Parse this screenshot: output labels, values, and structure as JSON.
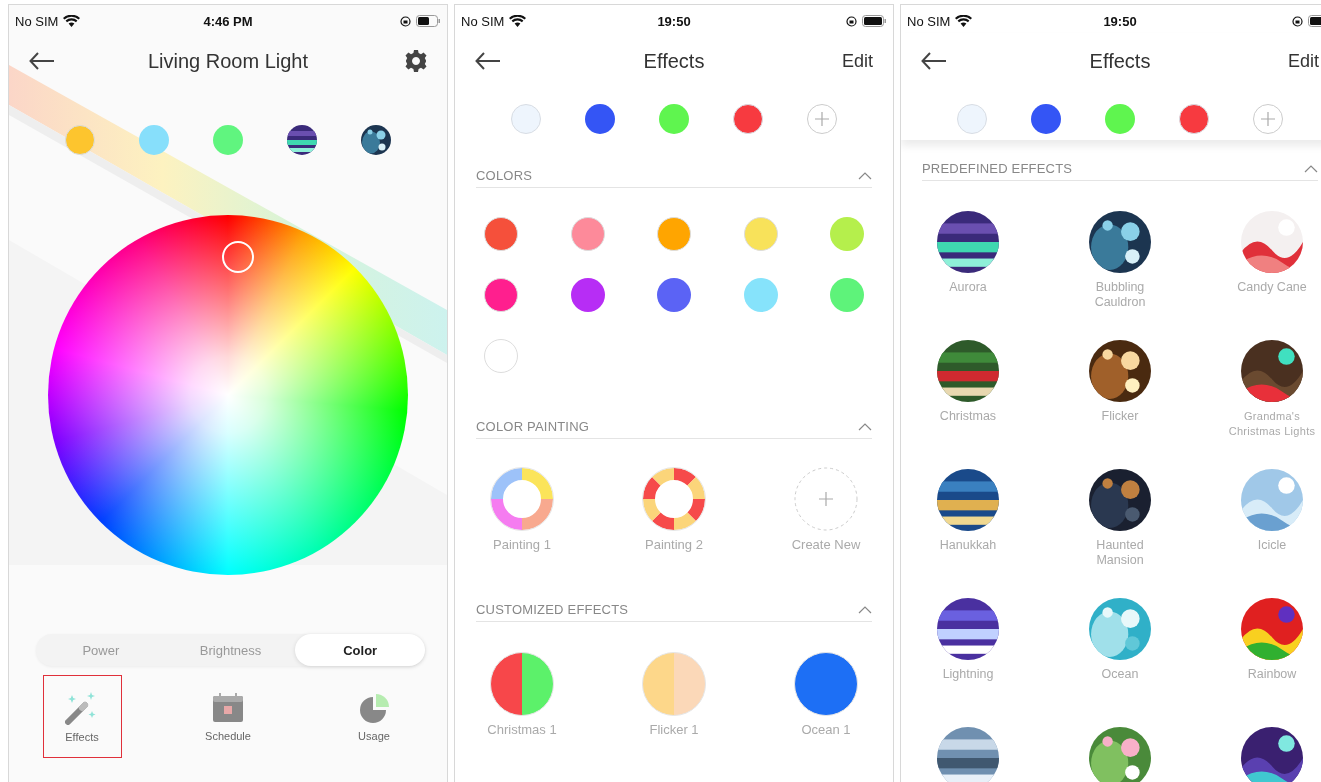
{
  "device": {
    "status_bar": {
      "carrier": "No SIM",
      "time": "4:46 PM"
    },
    "title": "Living Room Light",
    "favorites": [
      {
        "kind": "color",
        "color": "#fdc52e"
      },
      {
        "kind": "color",
        "color": "#87dffb"
      },
      {
        "kind": "color",
        "color": "#60f57f"
      },
      {
        "kind": "picture"
      },
      {
        "kind": "picture"
      }
    ],
    "tabs": [
      {
        "label": "Power",
        "selected": false
      },
      {
        "label": "Brightness",
        "selected": false
      },
      {
        "label": "Color",
        "selected": true
      }
    ],
    "bottom_nav": [
      {
        "kind": "effects",
        "label": "Effects",
        "highlighted": true
      },
      {
        "kind": "schedule",
        "label": "Schedule",
        "highlighted": false
      },
      {
        "kind": "usage",
        "label": "Usage",
        "highlighted": false
      }
    ]
  },
  "effects": {
    "status_bar": {
      "carrier": "No SIM",
      "time": "19:50"
    },
    "title": "Effects",
    "action": "Edit",
    "favorites": [
      {
        "kind": "color",
        "color": "#eef5fd"
      },
      {
        "kind": "color",
        "color": "#3455f5"
      },
      {
        "kind": "color",
        "color": "#5ff54f"
      },
      {
        "kind": "color",
        "color": "#f73a40"
      },
      {
        "kind": "add"
      }
    ],
    "sections": [
      {
        "kind": "colors",
        "title": "COLORS",
        "expanded": true,
        "items": [
          {
            "color": "#f5503b"
          },
          {
            "color": "#fd8a9a"
          },
          {
            "color": "#ffa500"
          },
          {
            "color": "#f8e25a"
          },
          {
            "color": "#b5ef4c"
          },
          {
            "color": "#ff1f8e"
          },
          {
            "color": "#b72df5"
          },
          {
            "color": "#5b63f5"
          },
          {
            "color": "#86e3fb"
          },
          {
            "color": "#5ef37a"
          },
          {
            "color": "#ffffff"
          }
        ]
      },
      {
        "kind": "paintings",
        "title": "COLOR PAINTING",
        "expanded": true,
        "items": [
          {
            "kind": "painting",
            "label": "Painting 1",
            "segments": [
              {
                "color": "#fbe45a"
              },
              {
                "color": "#f8a98f"
              },
              {
                "color": "#f57cf0"
              },
              {
                "color": "#9dc2f9"
              }
            ]
          },
          {
            "kind": "painting",
            "label": "Painting 2",
            "segments": [
              {
                "color": "#f64a4a"
              },
              {
                "color": "#fbd57a"
              },
              {
                "color": "#f64a4a"
              },
              {
                "color": "#fbd57a"
              },
              {
                "color": "#f64a4a"
              },
              {
                "color": "#fbd57a"
              },
              {
                "color": "#f64a4a"
              },
              {
                "color": "#fbd57a"
              }
            ]
          },
          {
            "kind": "add",
            "label": "Create New"
          }
        ]
      },
      {
        "kind": "custom",
        "title": "CUSTOMIZED EFFECTS",
        "expanded": true,
        "items": [
          {
            "label": "Christmas 1",
            "colors": [
              {
                "color": "#f7474a"
              },
              {
                "color": "#5cf16a"
              }
            ]
          },
          {
            "label": "Flicker 1",
            "colors": [
              {
                "color": "#fdd78a"
              },
              {
                "color": "#fbd8b8"
              }
            ]
          },
          {
            "label": "Ocean 1",
            "colors": [
              {
                "color": "#1d6ff5"
              }
            ]
          }
        ]
      }
    ]
  },
  "predefined": {
    "status_bar": {
      "carrier": "No SIM",
      "time": "19:50"
    },
    "title": "Effects",
    "action": "Edit",
    "favorites": [
      {
        "kind": "color",
        "color": "#eef5fd"
      },
      {
        "kind": "color",
        "color": "#3455f5"
      },
      {
        "kind": "color",
        "color": "#5ff54f"
      },
      {
        "kind": "color",
        "color": "#f73a40"
      },
      {
        "kind": "add"
      }
    ],
    "section": {
      "title": "PREDEFINED EFFECTS",
      "expanded": true,
      "items": [
        {
          "kind": "picture",
          "label": "Aurora"
        },
        {
          "kind": "picture",
          "label": "Bubbling Cauldron"
        },
        {
          "kind": "picture",
          "label": "Candy Cane"
        },
        {
          "kind": "picture",
          "label": "Christmas"
        },
        {
          "kind": "picture",
          "label": "Flicker"
        },
        {
          "kind": "picture",
          "label": "Grandma's Christmas Lights"
        },
        {
          "kind": "picture",
          "label": "Hanukkah"
        },
        {
          "kind": "picture",
          "label": "Haunted Mansion"
        },
        {
          "kind": "picture",
          "label": "Icicle"
        },
        {
          "kind": "picture",
          "label": "Lightning"
        },
        {
          "kind": "picture",
          "label": "Ocean"
        },
        {
          "kind": "picture",
          "label": "Rainbow"
        },
        {
          "kind": "picture"
        },
        {
          "kind": "picture"
        },
        {
          "kind": "picture"
        }
      ]
    }
  }
}
